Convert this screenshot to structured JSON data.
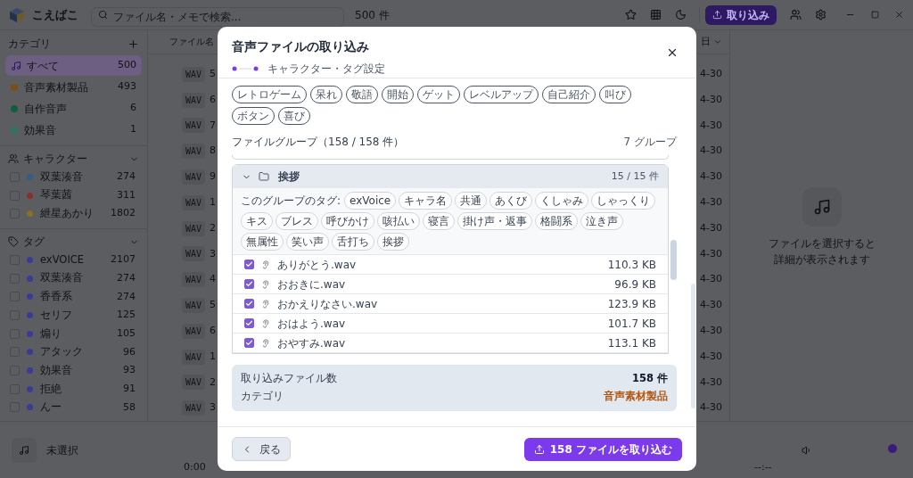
{
  "app": {
    "title": "こえばこ",
    "search": {
      "placeholder": "ファイル名・メモで検索..."
    },
    "count": "500 件",
    "import_button": "取り込み"
  },
  "sidebar": {
    "categories": {
      "title": "カテゴリ",
      "items": [
        {
          "kind": "all",
          "label": "すべて",
          "count": "500",
          "selected": true
        },
        {
          "kind": "dot",
          "label": "音声素材製品",
          "count": "493",
          "selected": false,
          "color": "#7a4e16"
        },
        {
          "kind": "dot",
          "label": "自作音声",
          "count": "6",
          "selected": false,
          "color": "#145c3c"
        },
        {
          "kind": "dot",
          "label": "効果音",
          "count": "1",
          "selected": false,
          "color": "#2f7662"
        }
      ]
    },
    "characters": {
      "title": "キャラクター",
      "items": [
        {
          "label": "双葉湊音",
          "count": "274",
          "checked": false,
          "color": "#345d85"
        },
        {
          "label": "琴葉茜",
          "count": "311",
          "checked": false,
          "color": "#8a2e2e"
        },
        {
          "label": "紲星あかり",
          "count": "1802",
          "checked": false,
          "color": "#86702c"
        }
      ]
    },
    "tags": {
      "title": "タグ",
      "items": [
        {
          "label": "exVOICE",
          "count": "2107",
          "checked": false,
          "color": "#3b3b94"
        },
        {
          "label": "双葉湊音",
          "count": "274",
          "checked": false,
          "color": "#3b3b94"
        },
        {
          "label": "香香系",
          "count": "274",
          "checked": false,
          "color": "#3b3b94"
        },
        {
          "label": "セリフ",
          "count": "125",
          "checked": false,
          "color": "#3b3b94"
        },
        {
          "label": "煽り",
          "count": "105",
          "checked": false,
          "color": "#3b3b94"
        },
        {
          "label": "アタック",
          "count": "96",
          "checked": false,
          "color": "#3b3b94"
        },
        {
          "label": "効果音",
          "count": "93",
          "checked": false,
          "color": "#3b3b94"
        },
        {
          "label": "拒絶",
          "count": "91",
          "checked": false,
          "color": "#3b3b94"
        },
        {
          "label": "んー",
          "count": "58",
          "checked": false,
          "color": "#3b3b94"
        }
      ]
    }
  },
  "file_list": {
    "columns": [
      "ファイル名",
      "日"
    ],
    "rows": [
      {
        "type": "WAV",
        "name": "5",
        "date": "4-30"
      },
      {
        "type": "WAV",
        "name": "6",
        "date": "4-30"
      },
      {
        "type": "WAV",
        "name": "7",
        "date": "4-30"
      },
      {
        "type": "WAV",
        "name": "8",
        "date": "4-30"
      },
      {
        "type": "WAV",
        "name": "9",
        "date": "4-30"
      },
      {
        "type": "WAV",
        "name": "1",
        "date": "4-30"
      },
      {
        "type": "WAV",
        "name": "2",
        "date": "4-30"
      },
      {
        "type": "WAV",
        "name": "3",
        "date": "4-30"
      },
      {
        "type": "WAV",
        "name": "4",
        "date": "4-30"
      },
      {
        "type": "WAV",
        "name": "5",
        "date": "4-30"
      },
      {
        "type": "WAV",
        "name": "6",
        "date": "4-30"
      },
      {
        "type": "WAV",
        "name": "1",
        "date": "4-30"
      },
      {
        "type": "WAV",
        "name": "2",
        "date": "4-30"
      },
      {
        "type": "WAV",
        "name": "3",
        "date": "4-30"
      }
    ]
  },
  "detail_panel": {
    "message_lines": [
      "ファイルを選択すると",
      "詳細が表示されます"
    ]
  },
  "player": {
    "title": "未選択",
    "elapsed": "0:00",
    "duration": "--:--"
  },
  "dialog": {
    "title": "音声ファイルの取り込み",
    "step_label": "キャラクター・タグ設定",
    "tag_chips": [
      "レトロゲーム",
      "呆れ",
      "敬語",
      "開始",
      "ゲット",
      "レベルアップ",
      "自己紹介",
      "叫び",
      "ボタン",
      "喜び"
    ],
    "groups_heading": "ファイルグループ（158 / 158 件）",
    "groups_count": "7 グループ",
    "group": {
      "name": "挨拶",
      "count": "15 / 15 件",
      "expanded": true,
      "tags_label": "このグループのタグ:",
      "tags": [
        "exVoice",
        "キャラ名",
        "共通",
        "あくび",
        "くしゃみ",
        "しゃっくり",
        "キス",
        "ブレス",
        "呼びかけ",
        "咳払い",
        "寝言",
        "掛け声・返事",
        "格闘系",
        "泣き声",
        "無属性",
        "笑い声",
        "舌打ち",
        "挨拶"
      ],
      "files": [
        {
          "name": "ありがとう.wav",
          "size": "110.3 KB",
          "checked": true
        },
        {
          "name": "おおきに.wav",
          "size": "96.9 KB",
          "checked": true
        },
        {
          "name": "おかえりなさい.wav",
          "size": "123.9 KB",
          "checked": true
        },
        {
          "name": "おはよう.wav",
          "size": "101.7 KB",
          "checked": true
        },
        {
          "name": "おやすみ.wav",
          "size": "113.1 KB",
          "checked": true
        }
      ]
    },
    "summary": [
      {
        "kind": "count",
        "label": "取り込みファイル数",
        "value": "158 件"
      },
      {
        "kind": "category",
        "label": "カテゴリ",
        "value": "音声素材製品"
      }
    ],
    "back_button": "戻る",
    "import_button": "158 ファイルを取り込む"
  }
}
